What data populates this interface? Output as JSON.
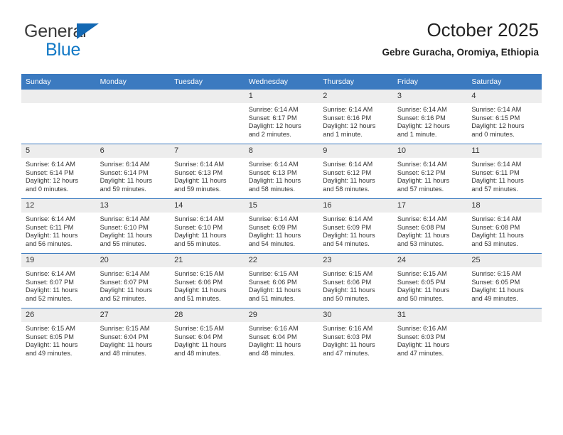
{
  "brand": {
    "name_top": "General",
    "name_bottom": "Blue",
    "triangle_color": "#1368b3",
    "blue_text_color": "#1379c6"
  },
  "header": {
    "title": "October 2025",
    "subtitle": "Gebre Guracha, Oromiya, Ethiopia"
  },
  "theme": {
    "header_bg": "#3b7ac0",
    "header_text": "#ffffff",
    "daynum_bg": "#ededed",
    "cell_text": "#333333",
    "row_border": "#3b7ac0"
  },
  "weekday_headers": [
    "Sunday",
    "Monday",
    "Tuesday",
    "Wednesday",
    "Thursday",
    "Friday",
    "Saturday"
  ],
  "weeks": [
    [
      {
        "day": "",
        "lines": []
      },
      {
        "day": "",
        "lines": []
      },
      {
        "day": "",
        "lines": []
      },
      {
        "day": "1",
        "lines": [
          "Sunrise: 6:14 AM",
          "Sunset: 6:17 PM",
          "Daylight: 12 hours",
          "and 2 minutes."
        ]
      },
      {
        "day": "2",
        "lines": [
          "Sunrise: 6:14 AM",
          "Sunset: 6:16 PM",
          "Daylight: 12 hours",
          "and 1 minute."
        ]
      },
      {
        "day": "3",
        "lines": [
          "Sunrise: 6:14 AM",
          "Sunset: 6:16 PM",
          "Daylight: 12 hours",
          "and 1 minute."
        ]
      },
      {
        "day": "4",
        "lines": [
          "Sunrise: 6:14 AM",
          "Sunset: 6:15 PM",
          "Daylight: 12 hours",
          "and 0 minutes."
        ]
      }
    ],
    [
      {
        "day": "5",
        "lines": [
          "Sunrise: 6:14 AM",
          "Sunset: 6:14 PM",
          "Daylight: 12 hours",
          "and 0 minutes."
        ]
      },
      {
        "day": "6",
        "lines": [
          "Sunrise: 6:14 AM",
          "Sunset: 6:14 PM",
          "Daylight: 11 hours",
          "and 59 minutes."
        ]
      },
      {
        "day": "7",
        "lines": [
          "Sunrise: 6:14 AM",
          "Sunset: 6:13 PM",
          "Daylight: 11 hours",
          "and 59 minutes."
        ]
      },
      {
        "day": "8",
        "lines": [
          "Sunrise: 6:14 AM",
          "Sunset: 6:13 PM",
          "Daylight: 11 hours",
          "and 58 minutes."
        ]
      },
      {
        "day": "9",
        "lines": [
          "Sunrise: 6:14 AM",
          "Sunset: 6:12 PM",
          "Daylight: 11 hours",
          "and 58 minutes."
        ]
      },
      {
        "day": "10",
        "lines": [
          "Sunrise: 6:14 AM",
          "Sunset: 6:12 PM",
          "Daylight: 11 hours",
          "and 57 minutes."
        ]
      },
      {
        "day": "11",
        "lines": [
          "Sunrise: 6:14 AM",
          "Sunset: 6:11 PM",
          "Daylight: 11 hours",
          "and 57 minutes."
        ]
      }
    ],
    [
      {
        "day": "12",
        "lines": [
          "Sunrise: 6:14 AM",
          "Sunset: 6:11 PM",
          "Daylight: 11 hours",
          "and 56 minutes."
        ]
      },
      {
        "day": "13",
        "lines": [
          "Sunrise: 6:14 AM",
          "Sunset: 6:10 PM",
          "Daylight: 11 hours",
          "and 55 minutes."
        ]
      },
      {
        "day": "14",
        "lines": [
          "Sunrise: 6:14 AM",
          "Sunset: 6:10 PM",
          "Daylight: 11 hours",
          "and 55 minutes."
        ]
      },
      {
        "day": "15",
        "lines": [
          "Sunrise: 6:14 AM",
          "Sunset: 6:09 PM",
          "Daylight: 11 hours",
          "and 54 minutes."
        ]
      },
      {
        "day": "16",
        "lines": [
          "Sunrise: 6:14 AM",
          "Sunset: 6:09 PM",
          "Daylight: 11 hours",
          "and 54 minutes."
        ]
      },
      {
        "day": "17",
        "lines": [
          "Sunrise: 6:14 AM",
          "Sunset: 6:08 PM",
          "Daylight: 11 hours",
          "and 53 minutes."
        ]
      },
      {
        "day": "18",
        "lines": [
          "Sunrise: 6:14 AM",
          "Sunset: 6:08 PM",
          "Daylight: 11 hours",
          "and 53 minutes."
        ]
      }
    ],
    [
      {
        "day": "19",
        "lines": [
          "Sunrise: 6:14 AM",
          "Sunset: 6:07 PM",
          "Daylight: 11 hours",
          "and 52 minutes."
        ]
      },
      {
        "day": "20",
        "lines": [
          "Sunrise: 6:14 AM",
          "Sunset: 6:07 PM",
          "Daylight: 11 hours",
          "and 52 minutes."
        ]
      },
      {
        "day": "21",
        "lines": [
          "Sunrise: 6:15 AM",
          "Sunset: 6:06 PM",
          "Daylight: 11 hours",
          "and 51 minutes."
        ]
      },
      {
        "day": "22",
        "lines": [
          "Sunrise: 6:15 AM",
          "Sunset: 6:06 PM",
          "Daylight: 11 hours",
          "and 51 minutes."
        ]
      },
      {
        "day": "23",
        "lines": [
          "Sunrise: 6:15 AM",
          "Sunset: 6:06 PM",
          "Daylight: 11 hours",
          "and 50 minutes."
        ]
      },
      {
        "day": "24",
        "lines": [
          "Sunrise: 6:15 AM",
          "Sunset: 6:05 PM",
          "Daylight: 11 hours",
          "and 50 minutes."
        ]
      },
      {
        "day": "25",
        "lines": [
          "Sunrise: 6:15 AM",
          "Sunset: 6:05 PM",
          "Daylight: 11 hours",
          "and 49 minutes."
        ]
      }
    ],
    [
      {
        "day": "26",
        "lines": [
          "Sunrise: 6:15 AM",
          "Sunset: 6:05 PM",
          "Daylight: 11 hours",
          "and 49 minutes."
        ]
      },
      {
        "day": "27",
        "lines": [
          "Sunrise: 6:15 AM",
          "Sunset: 6:04 PM",
          "Daylight: 11 hours",
          "and 48 minutes."
        ]
      },
      {
        "day": "28",
        "lines": [
          "Sunrise: 6:15 AM",
          "Sunset: 6:04 PM",
          "Daylight: 11 hours",
          "and 48 minutes."
        ]
      },
      {
        "day": "29",
        "lines": [
          "Sunrise: 6:16 AM",
          "Sunset: 6:04 PM",
          "Daylight: 11 hours",
          "and 48 minutes."
        ]
      },
      {
        "day": "30",
        "lines": [
          "Sunrise: 6:16 AM",
          "Sunset: 6:03 PM",
          "Daylight: 11 hours",
          "and 47 minutes."
        ]
      },
      {
        "day": "31",
        "lines": [
          "Sunrise: 6:16 AM",
          "Sunset: 6:03 PM",
          "Daylight: 11 hours",
          "and 47 minutes."
        ]
      },
      {
        "day": "",
        "lines": []
      }
    ]
  ]
}
